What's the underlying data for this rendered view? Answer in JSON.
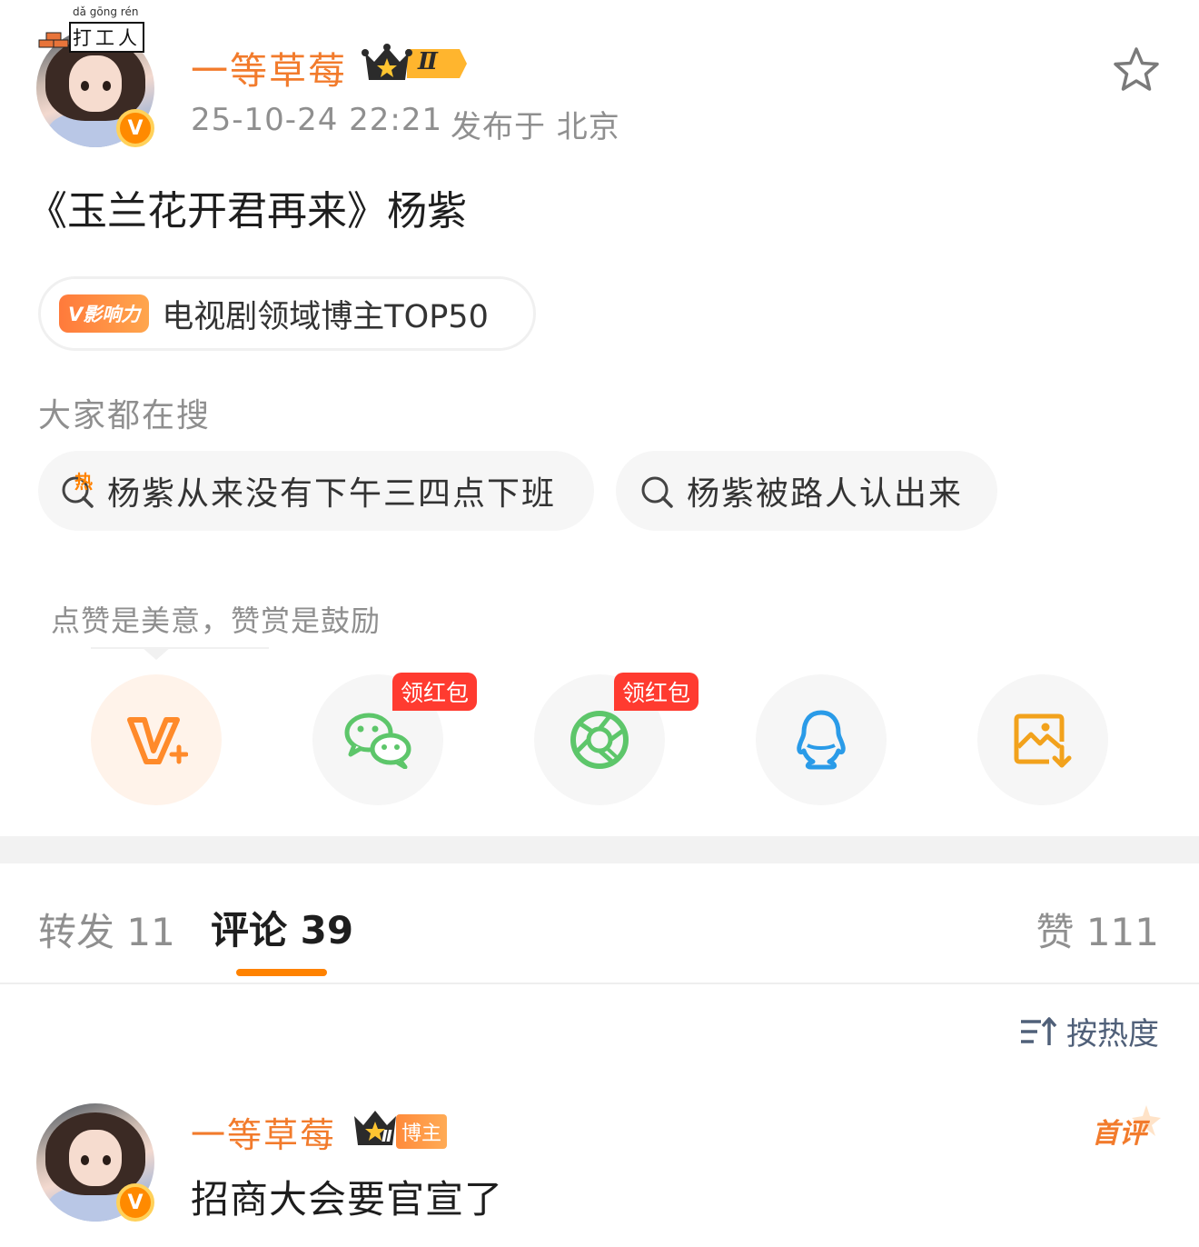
{
  "post": {
    "author": {
      "name": "一等草莓",
      "level_badge": "Ⅱ",
      "verified_mark": "V",
      "pendant_pinyin": "dǎ gōng rén",
      "pendant_text": "打工人"
    },
    "time": "25-10-24 22:21",
    "location": "发布于 北京",
    "text": "《玉兰花开君再来》杨紫"
  },
  "influence": {
    "tag": "V影响力",
    "text": "电视剧领域博主TOP50"
  },
  "searching": {
    "label": "大家都在搜",
    "items": [
      {
        "text": "杨紫从来没有下午三四点下班",
        "hot_mark": "热"
      },
      {
        "text": "杨紫被路人认出来"
      }
    ]
  },
  "share": {
    "tip": "点赞是美意，赞赏是鼓励",
    "buttons": [
      {
        "name": "reward",
        "icon": "v-plus-icon"
      },
      {
        "name": "wechat",
        "icon": "wechat-icon",
        "tag": "领红包"
      },
      {
        "name": "moments",
        "icon": "moments-icon",
        "tag": "领红包"
      },
      {
        "name": "qq",
        "icon": "qq-icon"
      },
      {
        "name": "save-image",
        "icon": "save-image-icon"
      }
    ]
  },
  "tabs": {
    "repost": "转发 11",
    "comment": "评论 39",
    "like": "赞 111"
  },
  "sort": {
    "label": "按热度"
  },
  "comment": {
    "author": "一等草莓",
    "blogger_tag": "博主",
    "level_badge": "Ⅱ",
    "first_tag": "首评",
    "text": "招商大会要官宣了"
  },
  "colors": {
    "accent_orange": "#f27b2c",
    "tab_indicator": "#ff8200",
    "red_tag": "#ff3b30",
    "wechat_green": "#5dc66a",
    "qq_blue": "#2a9be8",
    "save_orange": "#f2a21c"
  }
}
